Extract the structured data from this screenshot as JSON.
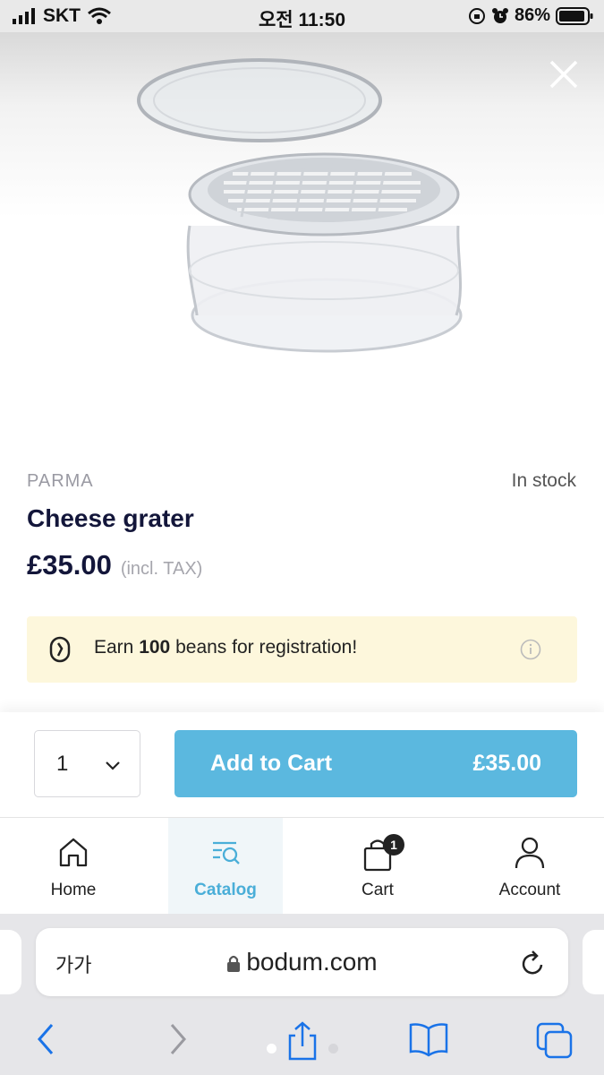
{
  "status_bar": {
    "carrier": "SKT",
    "time": "오전 11:50",
    "battery": "86%"
  },
  "product": {
    "brand": "PARMA",
    "stock": "In stock",
    "name": "Cheese grater",
    "price": "£35.00",
    "tax_note": "(incl. TAX)"
  },
  "promo": {
    "prefix": "Earn ",
    "amount": "100",
    "suffix": " beans for registration!"
  },
  "cart": {
    "quantity": "1",
    "add_label": "Add to Cart",
    "add_price": "£35.00"
  },
  "nav": {
    "items": [
      {
        "label": "Home",
        "icon": "home-icon"
      },
      {
        "label": "Catalog",
        "icon": "catalog-icon"
      },
      {
        "label": "Cart",
        "icon": "cart-icon",
        "badge": "1"
      },
      {
        "label": "Account",
        "icon": "account-icon"
      }
    ],
    "active": "Catalog"
  },
  "browser": {
    "text_size": "가가",
    "url": "bodum.com"
  },
  "colors": {
    "accent": "#5bb8df",
    "promo_bg": "#fdf7dc",
    "title": "#13163a",
    "link_blue": "#1a73e8"
  }
}
